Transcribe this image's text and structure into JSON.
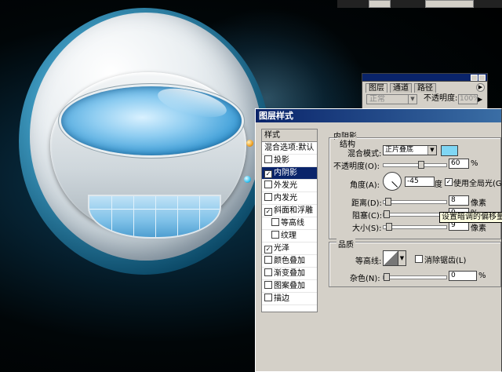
{
  "layers_panel": {
    "tabs": [
      "图层",
      "通道",
      "路径"
    ],
    "blend_mode": "正常",
    "opacity_label": "不透明度:",
    "opacity_value": "100%"
  },
  "dialog": {
    "title": "图层样式",
    "styles_header": "样式",
    "styles": [
      {
        "label": "混合选项:默认",
        "checkbox": false,
        "checked": false,
        "selected": false,
        "indent": false
      },
      {
        "label": "投影",
        "checkbox": true,
        "checked": false,
        "selected": false,
        "indent": false
      },
      {
        "label": "内阴影",
        "checkbox": true,
        "checked": true,
        "selected": true,
        "indent": false
      },
      {
        "label": "外发光",
        "checkbox": true,
        "checked": false,
        "selected": false,
        "indent": false
      },
      {
        "label": "内发光",
        "checkbox": true,
        "checked": false,
        "selected": false,
        "indent": false
      },
      {
        "label": "斜面和浮雕",
        "checkbox": true,
        "checked": true,
        "selected": false,
        "indent": false
      },
      {
        "label": "等高线",
        "checkbox": true,
        "checked": false,
        "selected": false,
        "indent": true
      },
      {
        "label": "纹理",
        "checkbox": true,
        "checked": false,
        "selected": false,
        "indent": true
      },
      {
        "label": "光泽",
        "checkbox": true,
        "checked": true,
        "selected": false,
        "indent": false
      },
      {
        "label": "颜色叠加",
        "checkbox": true,
        "checked": false,
        "selected": false,
        "indent": false
      },
      {
        "label": "渐变叠加",
        "checkbox": true,
        "checked": false,
        "selected": false,
        "indent": false
      },
      {
        "label": "图案叠加",
        "checkbox": true,
        "checked": false,
        "selected": false,
        "indent": false
      },
      {
        "label": "描边",
        "checkbox": true,
        "checked": false,
        "selected": false,
        "indent": false
      }
    ],
    "inner_shadow": {
      "section_title": "内阴影",
      "structure_title": "结构",
      "blend_mode_label": "混合模式:",
      "blend_mode_value": "正片叠底",
      "shadow_color": "#7fd6f4",
      "opacity_label": "不透明度(O):",
      "opacity_value": "60",
      "opacity_unit": "%",
      "opacity_fraction": 0.6,
      "angle_label": "角度(A):",
      "angle_value": "-45",
      "angle_unit": "度",
      "global_light_label": "使用全局光(G)",
      "global_light_checked": true,
      "distance_label": "距离(D):",
      "distance_value": "8",
      "distance_unit": "像素",
      "distance_fraction": 0.03,
      "choke_label": "阻塞(C):",
      "choke_value": "0",
      "choke_unit": "%",
      "choke_fraction": 0.0,
      "size_label": "大小(S):",
      "size_value": "9",
      "size_unit": "像素",
      "size_fraction": 0.04,
      "tooltip": "设置暗调的偏移量",
      "quality_title": "品质",
      "contour_label": "等高线:",
      "anti_alias_label": "消除锯齿(L)",
      "anti_alias_checked": false,
      "noise_label": "杂色(N):",
      "noise_value": "0",
      "noise_unit": "%",
      "noise_fraction": 0.0
    }
  }
}
